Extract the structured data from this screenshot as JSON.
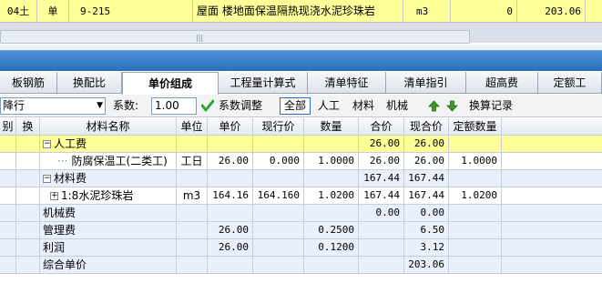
{
  "top_row": {
    "c1": "04土",
    "c2": "单",
    "code": "9-215",
    "name": "屋面 楼地面保温隔热现浇水泥珍珠岩",
    "unit": "m3",
    "qty": "0",
    "price": "203.06"
  },
  "scroll_grip": "|||",
  "tabs": [
    "板钢筋",
    "换配比",
    "单价组成",
    "工程量计算式",
    "清单特征",
    "清单指引",
    "超高费",
    "定额工"
  ],
  "active_tab": "单价组成",
  "toolbar": {
    "combo_value": "降行",
    "coef_label": "系数:",
    "coef_value": "1.00",
    "adjust_label": "系数调整",
    "filter_all": "全部",
    "filter_labor": "人工",
    "filter_material": "材料",
    "filter_machine": "机械",
    "convert_record": "换算记录"
  },
  "headers": [
    "别",
    "换",
    "材料名称",
    "单位",
    "单价",
    "现行价",
    "数量",
    "合价",
    "现合价",
    "定额数量"
  ],
  "rows": [
    {
      "style": "yellow",
      "toggle": "−",
      "indent": 0,
      "name": "人工费",
      "unit": "",
      "price": "",
      "cur": "",
      "qty": "",
      "total": "26.00",
      "curtotal": "26.00",
      "dqty": ""
    },
    {
      "style": "white",
      "toggle": "",
      "indent": 2,
      "name": "防腐保温工(二类工)",
      "unit": "工日",
      "price": "26.00",
      "cur": "0.000",
      "qty": "1.0000",
      "total": "26.00",
      "curtotal": "26.00",
      "dqty": "1.0000"
    },
    {
      "style": "lblue",
      "toggle": "−",
      "indent": 0,
      "name": "材料费",
      "unit": "",
      "price": "",
      "cur": "",
      "qty": "",
      "total": "167.44",
      "curtotal": "167.44",
      "dqty": ""
    },
    {
      "style": "white",
      "toggle": "+",
      "indent": 1,
      "name": "1:8水泥珍珠岩",
      "unit": "m3",
      "price": "164.16",
      "cur": "164.160",
      "qty": "1.0200",
      "total": "167.44",
      "curtotal": "167.44",
      "dqty": "1.0200"
    },
    {
      "style": "lblue",
      "toggle": "",
      "indent": 0,
      "name": "机械费",
      "unit": "",
      "price": "",
      "cur": "",
      "qty": "",
      "total": "0.00",
      "curtotal": "0.00",
      "dqty": ""
    },
    {
      "style": "lblue",
      "toggle": "",
      "indent": 0,
      "name": "管理费",
      "unit": "",
      "price": "26.00",
      "cur": "",
      "qty": "0.2500",
      "total": "",
      "curtotal": "6.50",
      "dqty": ""
    },
    {
      "style": "lblue",
      "toggle": "",
      "indent": 0,
      "name": "利润",
      "unit": "",
      "price": "26.00",
      "cur": "",
      "qty": "0.1200",
      "total": "",
      "curtotal": "3.12",
      "dqty": ""
    },
    {
      "style": "lblue",
      "toggle": "",
      "indent": 0,
      "name": "综合单价",
      "unit": "",
      "price": "",
      "cur": "",
      "qty": "",
      "total": "",
      "curtotal": "203.06",
      "dqty": ""
    }
  ]
}
